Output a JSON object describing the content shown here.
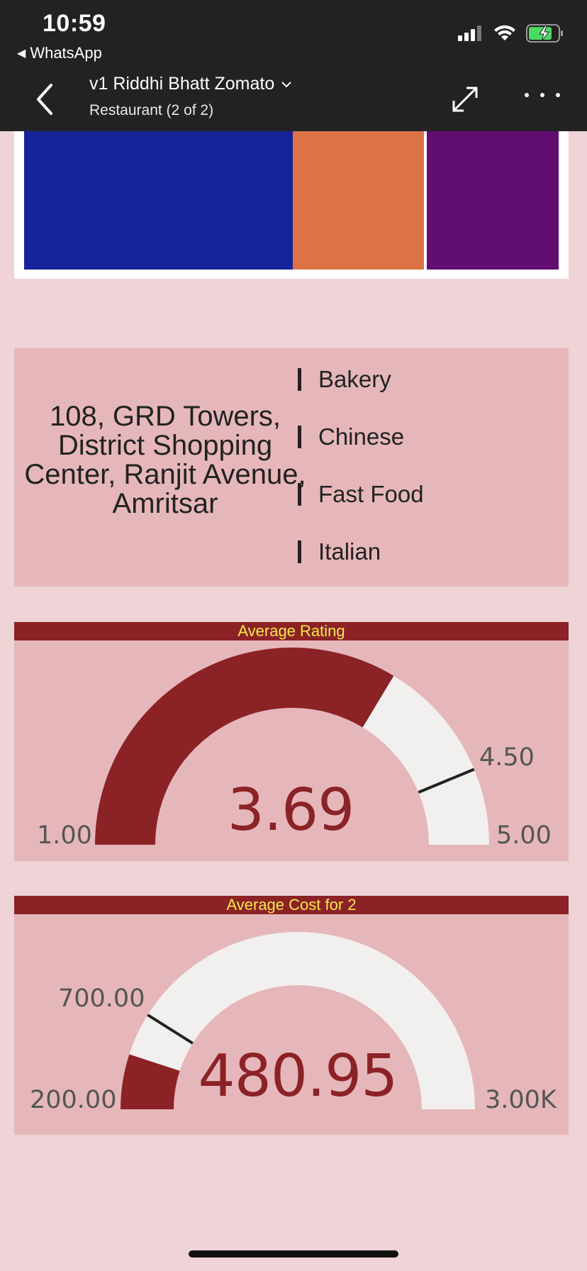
{
  "status_bar": {
    "time": "10:59",
    "back_app": "WhatsApp"
  },
  "header": {
    "title": "v1 Riddhi Bhatt Zomato",
    "subtitle": "Restaurant (2 of 2)"
  },
  "treemap": {
    "tiles": [
      {
        "color": "#152299"
      },
      {
        "color": "#dc7346"
      },
      {
        "color": "#620d72"
      }
    ]
  },
  "restaurant": {
    "address": "108, GRD Towers, District Shopping Center, Ranjit Avenue, Amritsar",
    "cuisines": [
      "Bakery",
      "Chinese",
      "Fast Food",
      "Italian"
    ]
  },
  "gauges": {
    "rating": {
      "title": "Average Rating",
      "value": 3.69,
      "value_label": "3.69",
      "min": 1.0,
      "min_label": "1.00",
      "max": 5.0,
      "max_label": "5.00",
      "target": 4.5,
      "target_label": "4.50"
    },
    "cost": {
      "title": "Average Cost for 2",
      "value": 480.95,
      "value_label": "480.95",
      "min": 200.0,
      "min_label": "200.00",
      "max": 3000.0,
      "max_label": "3.00K",
      "target": 700.0,
      "target_label": "700.00"
    }
  },
  "colors": {
    "gauge_fill": "#8b2226",
    "gauge_track": "#f2f0ef",
    "card_bg": "#e6b7ba",
    "page_bg": "#efd3d6",
    "header_text": "#f5e84a"
  }
}
